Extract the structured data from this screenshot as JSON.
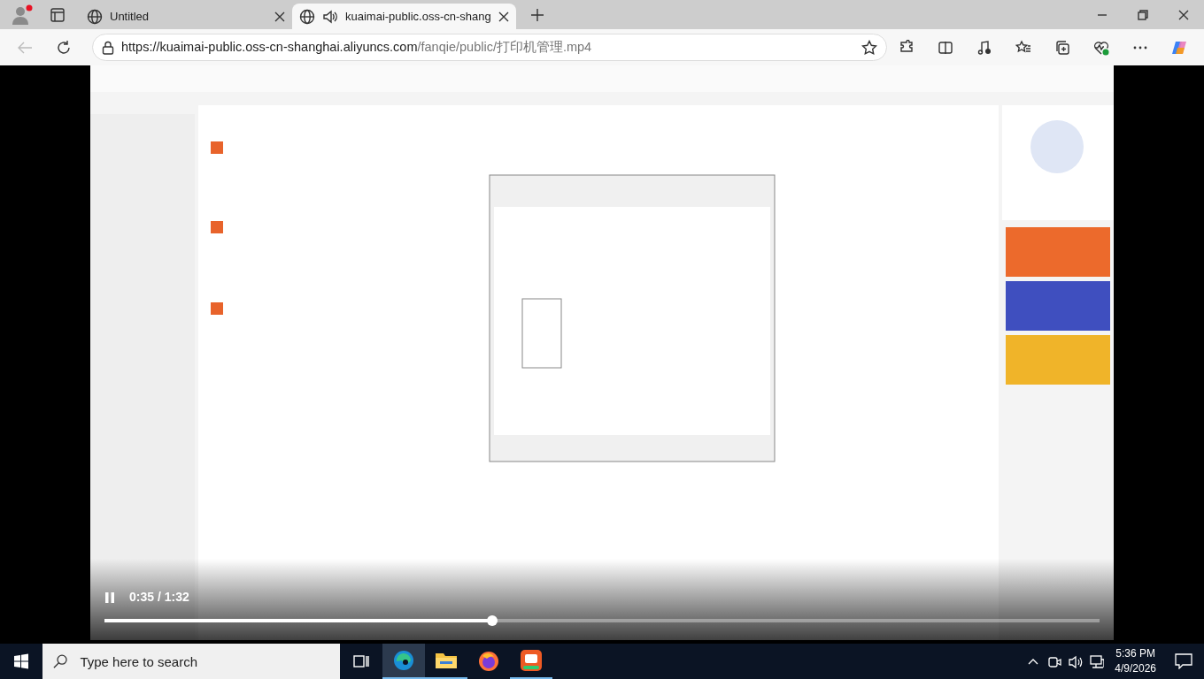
{
  "browser": {
    "tabs": [
      {
        "title": "Untitled",
        "selected": false,
        "audio": false
      },
      {
        "title": "kuaimai-public.oss-cn-shang",
        "selected": true,
        "audio": true
      }
    ],
    "address": {
      "host": "https://kuaimai-public.oss-cn-shanghai.aliyuncs.com",
      "path": "/fanqie/public/打印机管理.mp4"
    }
  },
  "video": {
    "kind": "picture",
    "playing": true,
    "time": "0:35 / 1:32",
    "level": 0.39
  },
  "taskbar": {
    "search_placeholder": "Type here to search",
    "time": "5:36 PM",
    "date": "4/9/2026"
  }
}
